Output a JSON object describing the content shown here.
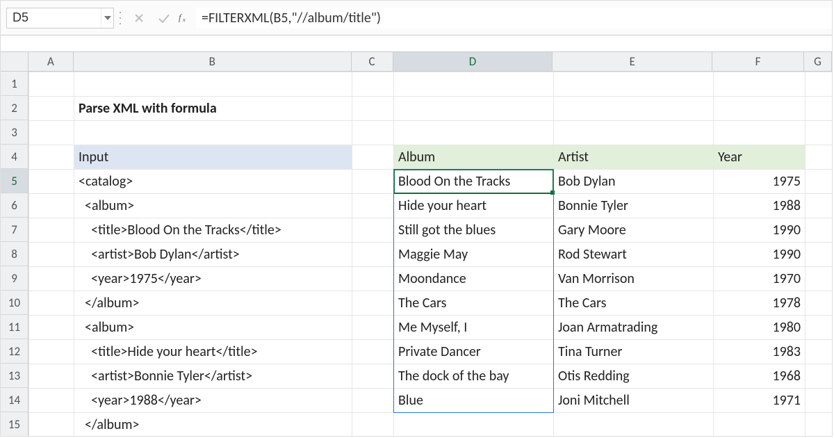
{
  "namebox": {
    "value": "D5"
  },
  "formula_bar": {
    "value": "=FILTERXML(B5,\"//album/title\")"
  },
  "columns": [
    "A",
    "B",
    "C",
    "D",
    "E",
    "F",
    "G"
  ],
  "rows": [
    "1",
    "2",
    "3",
    "4",
    "5",
    "6",
    "7",
    "8",
    "9",
    "10",
    "11",
    "12",
    "13",
    "14",
    "15"
  ],
  "title": "Parse XML with formula",
  "input_header": "Input",
  "headers": {
    "album": "Album",
    "artist": "Artist",
    "year": "Year"
  },
  "xml_lines": [
    "<catalog>",
    "  <album>",
    "    <title>Blood On the Tracks</title>",
    "    <artist>Bob Dylan</artist>",
    "    <year>1975</year>",
    "  </album>",
    "  <album>",
    "    <title>Hide your heart</title>",
    "    <artist>Bonnie Tyler</artist>",
    "    <year>1988</year>",
    "  </album>"
  ],
  "table": [
    {
      "album": "Blood On the Tracks",
      "artist": "Bob Dylan",
      "year": "1975"
    },
    {
      "album": "Hide your heart",
      "artist": "Bonnie Tyler",
      "year": "1988"
    },
    {
      "album": "Still got the blues",
      "artist": "Gary Moore",
      "year": "1990"
    },
    {
      "album": "Maggie May",
      "artist": "Rod Stewart",
      "year": "1990"
    },
    {
      "album": "Moondance",
      "artist": "Van Morrison",
      "year": "1970"
    },
    {
      "album": "The Cars",
      "artist": "The Cars",
      "year": "1978"
    },
    {
      "album": "Me Myself, I",
      "artist": "Joan Armatrading",
      "year": "1980"
    },
    {
      "album": "Private Dancer",
      "artist": "Tina Turner",
      "year": "1983"
    },
    {
      "album": "The dock of the bay",
      "artist": "Otis Redding",
      "year": "1968"
    },
    {
      "album": "Blue",
      "artist": "Joni Mitchell",
      "year": "1971"
    }
  ],
  "active_cell": "D5",
  "colors": {
    "selection_green": "#0f6e3e",
    "spill_blue": "#2e75cf",
    "table_header_green": "#e2efda",
    "input_header_blue": "#dee5f2"
  },
  "chart_data": {
    "type": "table",
    "columns": [
      "Album",
      "Artist",
      "Year"
    ],
    "rows": [
      [
        "Blood On the Tracks",
        "Bob Dylan",
        1975
      ],
      [
        "Hide your heart",
        "Bonnie Tyler",
        1988
      ],
      [
        "Still got the blues",
        "Gary Moore",
        1990
      ],
      [
        "Maggie May",
        "Rod Stewart",
        1990
      ],
      [
        "Moondance",
        "Van Morrison",
        1970
      ],
      [
        "The Cars",
        "The Cars",
        1978
      ],
      [
        "Me Myself, I",
        "Joan Armatrading",
        1980
      ],
      [
        "Private Dancer",
        "Tina Turner",
        1983
      ],
      [
        "The dock of the bay",
        "Otis Redding",
        1968
      ],
      [
        "Blue",
        "Joni Mitchell",
        1971
      ]
    ]
  }
}
